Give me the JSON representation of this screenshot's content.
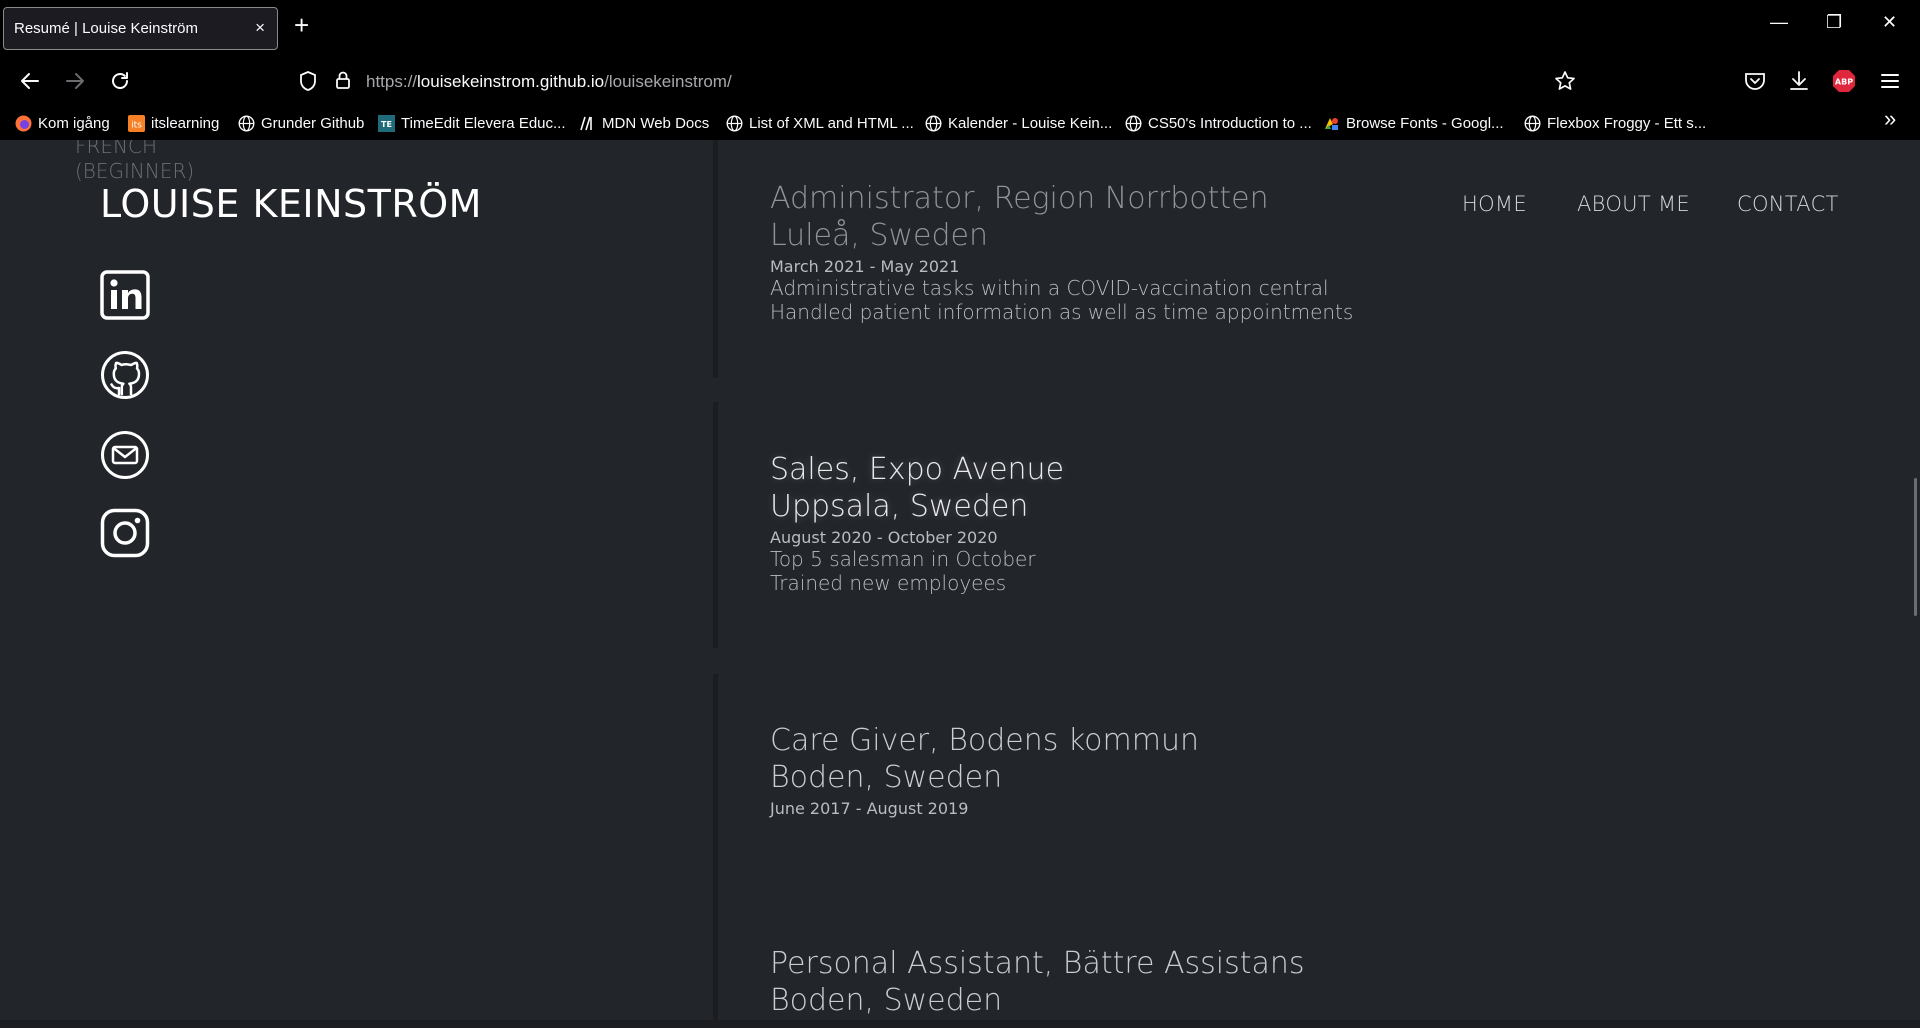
{
  "browser": {
    "tab_title": "Resumé | Louise Keinström",
    "tab_close": "×",
    "new_tab": "+",
    "url_scheme": "https://",
    "url_host": "louisekeinstrom.github.io",
    "url_path": "/louisekeinstrom/",
    "window_controls": {
      "minimize": "—",
      "restore": "❐",
      "close": "✕"
    },
    "bookmarks": [
      {
        "label": "Kom igång",
        "icon": "firefox-icon"
      },
      {
        "label": "itslearning",
        "icon": "itslearning-icon"
      },
      {
        "label": "Grunder Github",
        "icon": "globe-icon"
      },
      {
        "label": "TimeEdit Elevera Educ...",
        "icon": "timeedit-icon"
      },
      {
        "label": "MDN Web Docs",
        "icon": "mdn-icon"
      },
      {
        "label": "List of XML and HTML ...",
        "icon": "globe-icon"
      },
      {
        "label": "Kalender - Louise Kein...",
        "icon": "globe-icon"
      },
      {
        "label": "CS50's Introduction to ...",
        "icon": "globe-icon"
      },
      {
        "label": "Browse Fonts - Googl...",
        "icon": "google-fonts-icon"
      },
      {
        "label": "Flexbox Froggy - Ett s...",
        "icon": "globe-icon"
      }
    ],
    "bookmarks_overflow": "»"
  },
  "sidebar": {
    "faded_language": "FRENCH",
    "faded_level": "(BEGINNER)",
    "title": "LOUISE KEINSTRÖM",
    "socials": [
      "linkedin-icon",
      "github-icon",
      "mail-icon",
      "instagram-icon"
    ]
  },
  "nav": {
    "home": "HOME",
    "about": "ABOUT ME",
    "contact": "CONTACT"
  },
  "jobs": [
    {
      "title": "Administrator, Region Norrbotten",
      "location": "Luleå, Sweden",
      "dates": "March 2021 - May 2021",
      "desc": [
        "Administrative tasks within a COVID-vaccination central",
        "Handled patient information as well as time appointments"
      ]
    },
    {
      "title": "Sales, Expo Avenue",
      "location": "Uppsala, Sweden",
      "dates": "August 2020 - October 2020",
      "desc": [
        "Top 5 salesman in October",
        "Trained new employees"
      ]
    },
    {
      "title": "Care Giver, Bodens kommun",
      "location": "Boden, Sweden",
      "dates": "June 2017 - August 2019",
      "desc": []
    },
    {
      "title": "Personal Assistant, Bättre Assistans",
      "location": "Boden, Sweden",
      "dates": "",
      "desc": []
    }
  ],
  "colors": {
    "page_bg": "#22252a",
    "text": "#c9ccd1",
    "chrome_bg": "#000000"
  }
}
